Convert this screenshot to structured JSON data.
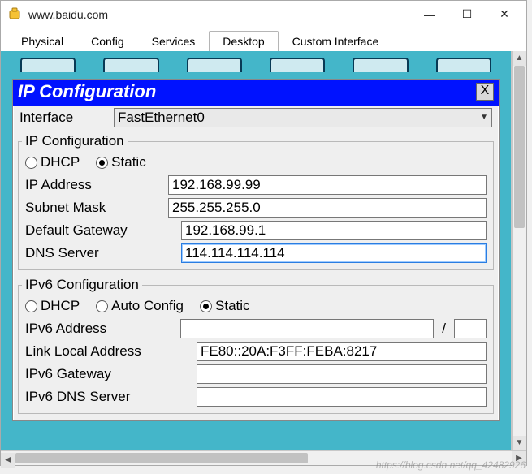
{
  "window": {
    "url": "www.baidu.com",
    "controls": {
      "min": "—",
      "max": "☐",
      "close": "✕"
    }
  },
  "tabs": [
    "Physical",
    "Config",
    "Services",
    "Desktop",
    "Custom Interface"
  ],
  "active_tab_index": 3,
  "ipconf": {
    "title": "IP Configuration",
    "close": "X",
    "interface_label": "Interface",
    "interface_value": "FastEthernet0",
    "ipv4": {
      "legend": "IP Configuration",
      "modes": [
        "DHCP",
        "Static"
      ],
      "mode_selected": 1,
      "fields": {
        "ip_label": "IP Address",
        "ip_value": "192.168.99.99",
        "mask_label": "Subnet Mask",
        "mask_value": "255.255.255.0",
        "gw_label": "Default Gateway",
        "gw_value": "192.168.99.1",
        "dns_label": "DNS Server",
        "dns_value": "114.114.114.114"
      }
    },
    "ipv6": {
      "legend": "IPv6 Configuration",
      "modes": [
        "DHCP",
        "Auto Config",
        "Static"
      ],
      "mode_selected": 2,
      "fields": {
        "addr_label": "IPv6 Address",
        "addr_value": "",
        "prefix_value": "",
        "ll_label": "Link Local Address",
        "ll_value": "FE80::20A:F3FF:FEBA:8217",
        "gw_label": "IPv6 Gateway",
        "gw_value": "",
        "dns_label": "IPv6 DNS Server",
        "dns_value": ""
      }
    }
  },
  "watermark": "https://blog.csdn.net/qq_42482926"
}
